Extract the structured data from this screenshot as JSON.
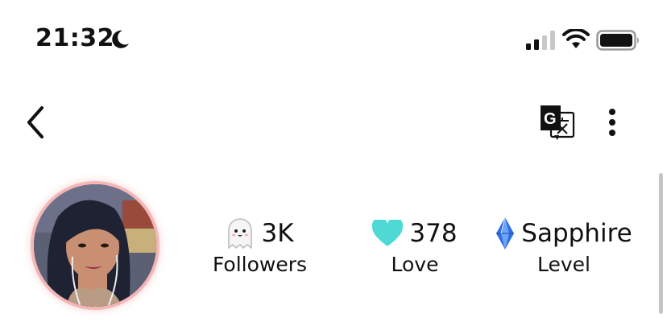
{
  "status_bar": {
    "time": "21:32",
    "icons": [
      "moon-icon",
      "cellular-signal-icon",
      "wifi-icon",
      "battery-icon"
    ]
  },
  "nav": {
    "icons": [
      "back-chevron-icon",
      "translate-icon",
      "more-vertical-icon"
    ]
  },
  "profile": {
    "stats": {
      "followers": {
        "value": "3K",
        "label": "Followers",
        "icon": "ghost-icon"
      },
      "love": {
        "value": "378",
        "label": "Love",
        "icon": "heart-icon",
        "color": "#4fd9d4"
      },
      "level": {
        "value": "Sapphire",
        "label": "Level",
        "icon": "sapphire-gem-icon",
        "color": "#2f6fe0"
      }
    }
  },
  "colors": {
    "avatar_ring": "#f4b6b6",
    "heart": "#4fd9d4",
    "gem": "#2f6fe0"
  }
}
